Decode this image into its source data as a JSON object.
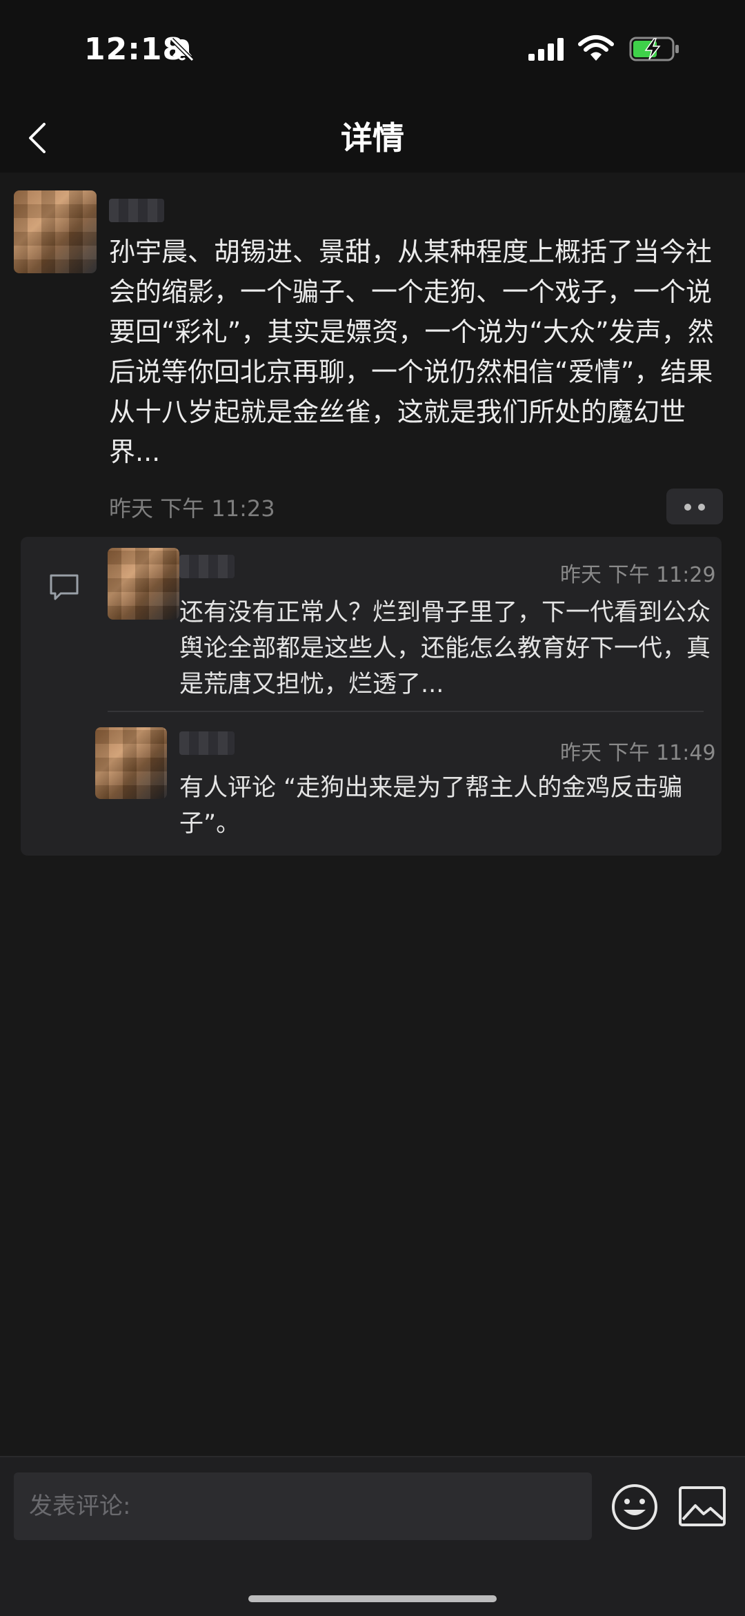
{
  "status_bar": {
    "time": "12:18"
  },
  "header": {
    "title": "详情"
  },
  "post": {
    "text": "孙宇晨、胡锡进、景甜，从某种程度上概括了当今社会的缩影，一个骗子、一个走狗、一个戏子，一个说要回“彩礼”，其实是嫖资，一个说为“大众”发声，然后说等你回北京再聊，一个说仍然相信“爱情”，结果从十八岁起就是金丝雀，这就是我们所处的魔幻世界...",
    "time": "昨天 下午 11:23"
  },
  "comments": [
    {
      "time": "昨天 下午 11:29",
      "text": "还有没有正常人？烂到骨子里了，下一代看到公众舆论全部都是这些人，还能怎么教育好下一代，真是荒唐又担忧，烂透了..."
    },
    {
      "time": "昨天 下午 11:49",
      "text": "有人评论 “走狗出来是为了帮主人的金鸡反击骗子”。"
    }
  ],
  "composer": {
    "placeholder": "发表评论:"
  }
}
